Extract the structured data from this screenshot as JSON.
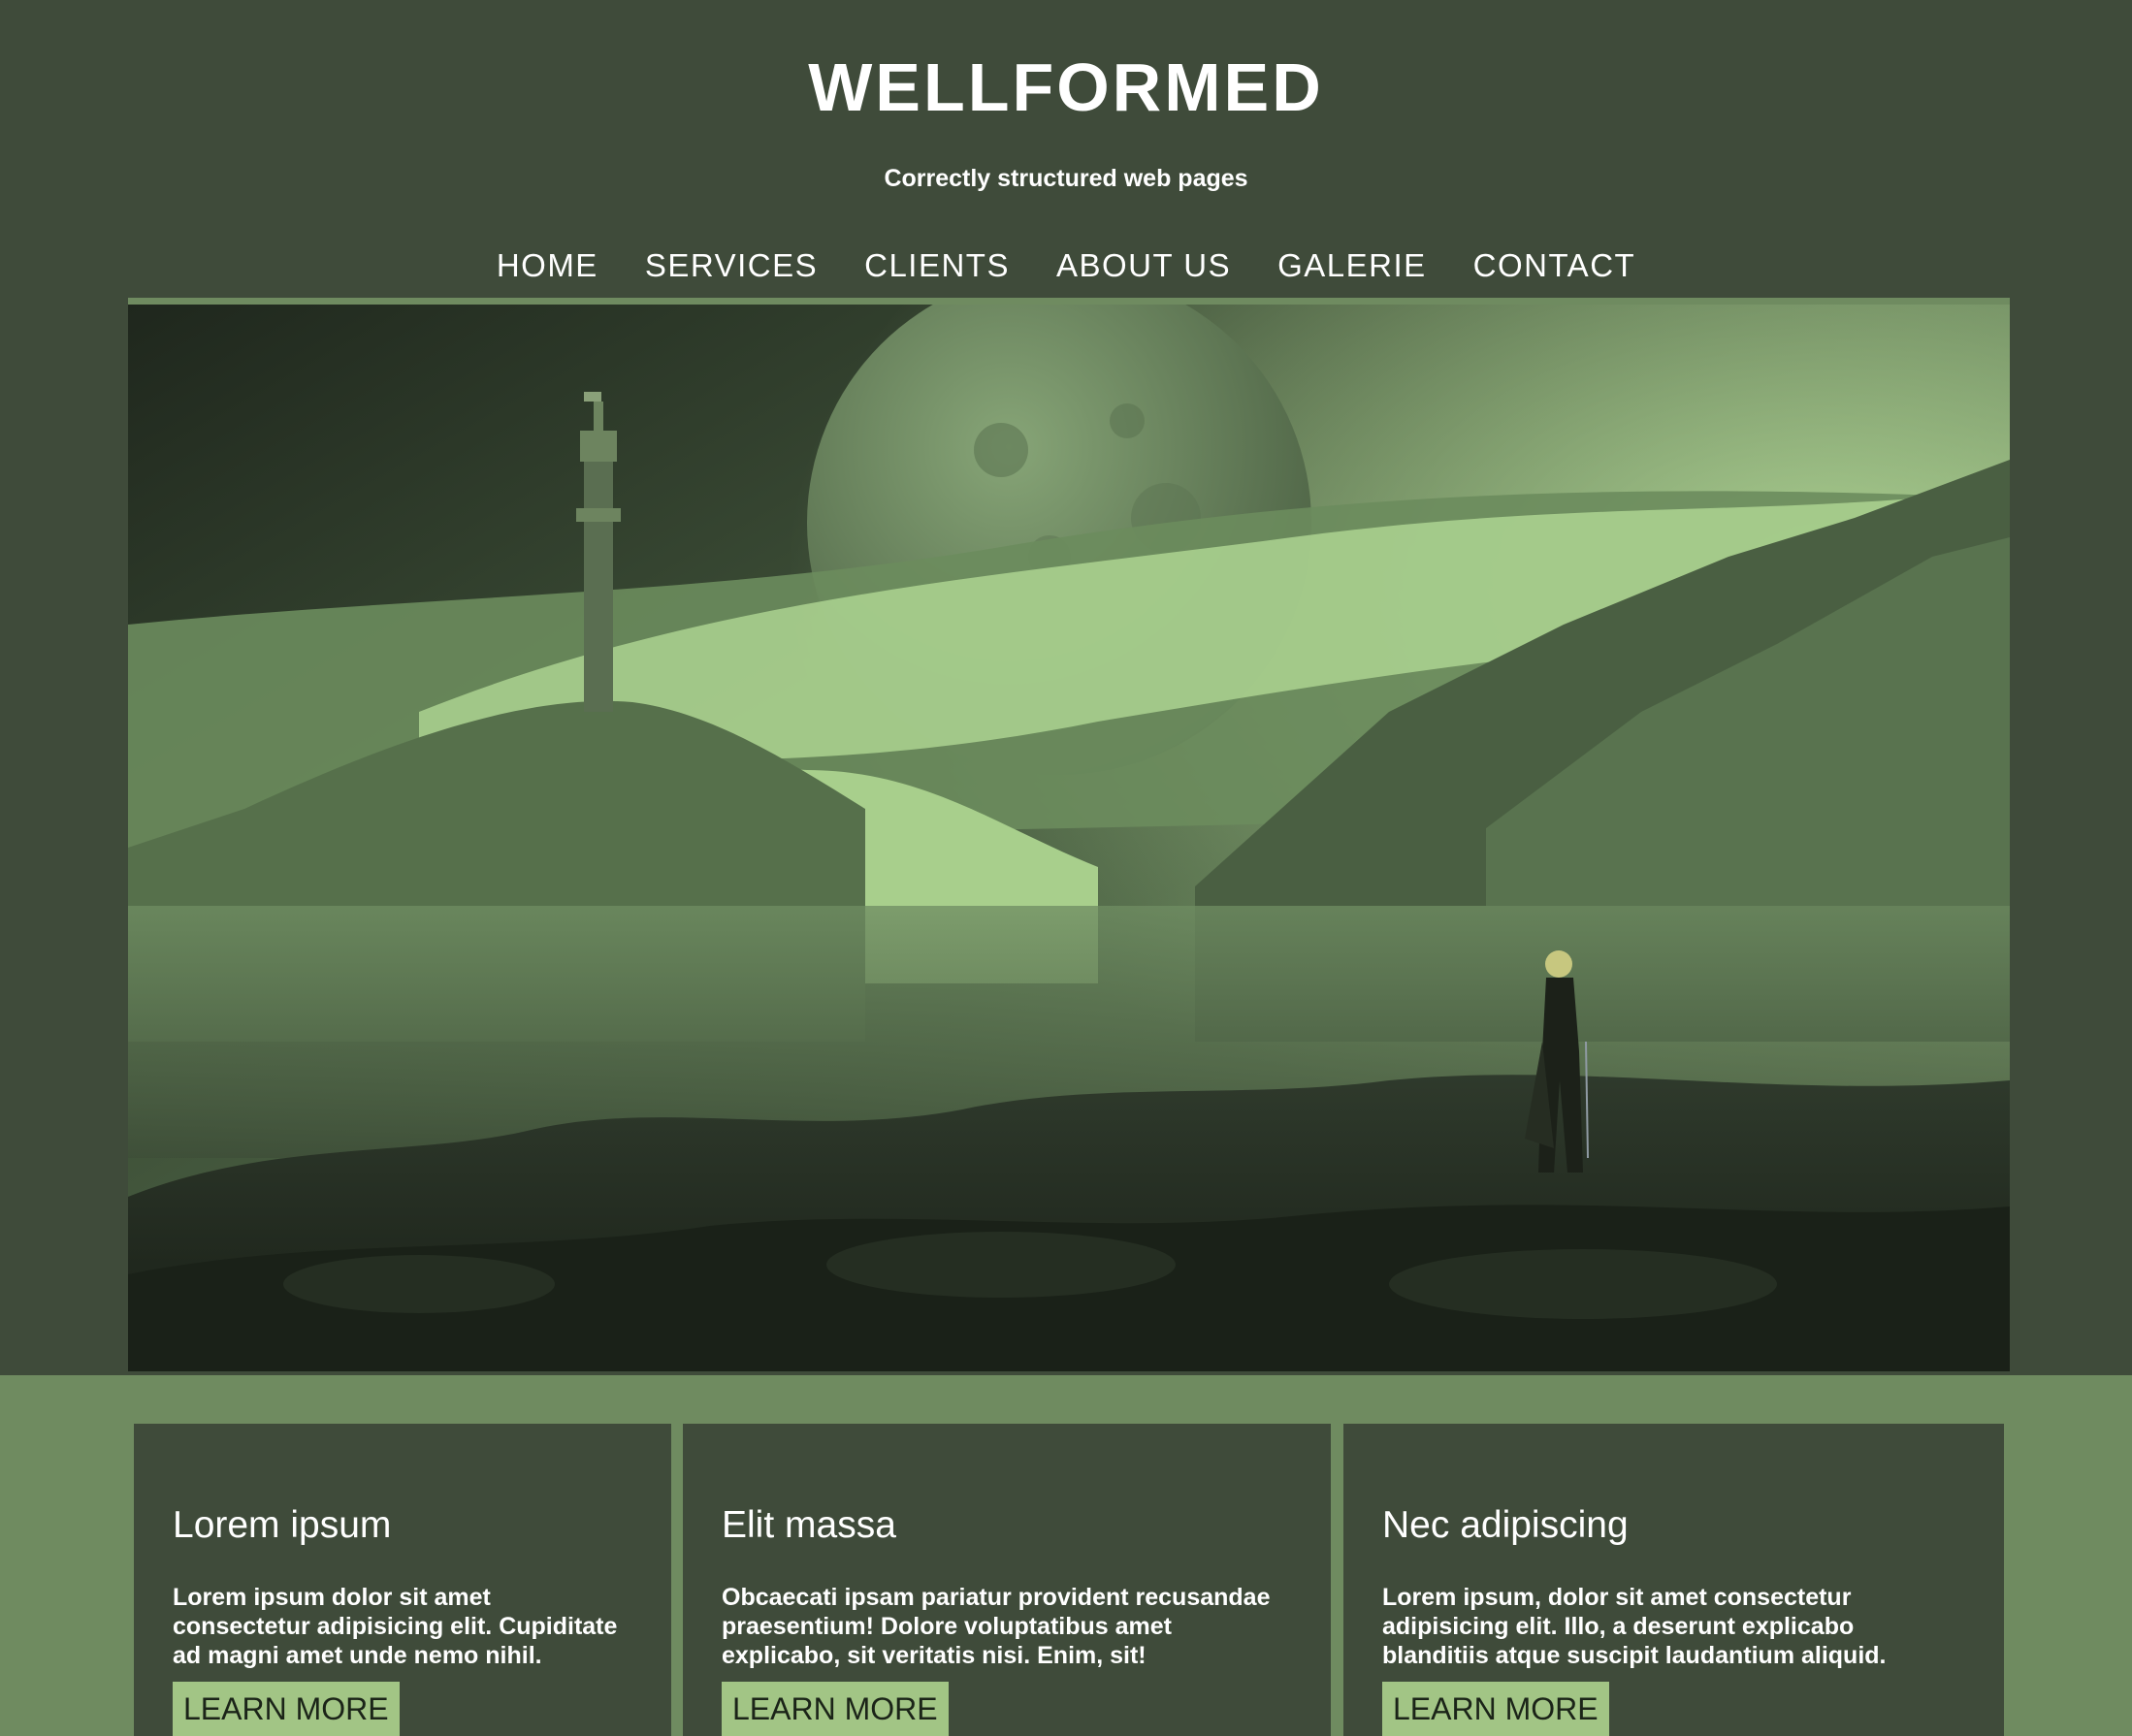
{
  "header": {
    "site_title": "WELLFORMED",
    "tagline": "Correctly structured web pages"
  },
  "nav": {
    "items": [
      {
        "label": "HOME"
      },
      {
        "label": "SERVICES"
      },
      {
        "label": "CLIENTS"
      },
      {
        "label": "ABOUT US"
      },
      {
        "label": "GALERIE"
      },
      {
        "label": "CONTACT"
      }
    ]
  },
  "hero": {
    "image": "fantasy-landscape-moon-tower-warrior"
  },
  "cards": [
    {
      "title": "Lorem ipsum",
      "text": "Lorem ipsum dolor sit amet consectetur adipisicing elit. Cupiditate ad magni amet unde nemo nihil.",
      "button": "LEARN MORE"
    },
    {
      "title": "Elit massa",
      "text": "Obcaecati ipsam pariatur provident recusandae praesentium! Dolore voluptatibus amet explicabo, sit veritatis nisi. Enim, sit!",
      "button": "LEARN MORE"
    },
    {
      "title": "Nec adipiscing",
      "text": "Lorem ipsum, dolor sit amet consectetur adipisicing elit. Illo, a deserunt explicabo blanditiis atque suscipit laudantium aliquid.",
      "button": "LEARN MORE"
    }
  ],
  "colors": {
    "background": "#3f4b3a",
    "accent": "#6f8b60",
    "button": "#a2c585",
    "text": "#ffffff"
  }
}
